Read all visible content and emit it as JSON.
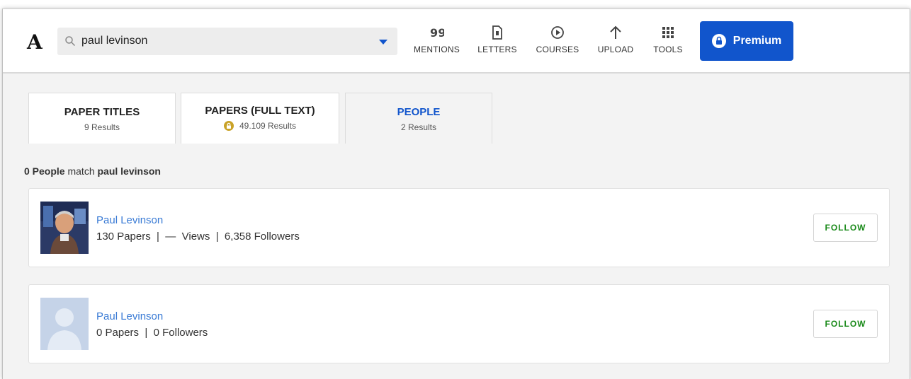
{
  "header": {
    "logo": "A",
    "search": {
      "value": "paul levinson",
      "placeholder": "Search"
    },
    "nav": [
      {
        "label": "MENTIONS",
        "icon": "quote-icon"
      },
      {
        "label": "LETTERS",
        "icon": "document-icon"
      },
      {
        "label": "COURSES",
        "icon": "play-circle-icon"
      },
      {
        "label": "UPLOAD",
        "icon": "arrow-up-icon"
      },
      {
        "label": "TOOLS",
        "icon": "grid-icon"
      }
    ],
    "premium_label": "Premium"
  },
  "tabs": [
    {
      "title": "PAPER TITLES",
      "sub": "9 Results"
    },
    {
      "title": "PAPERS (FULL TEXT)",
      "sub": "49.109 Results"
    },
    {
      "title": "PEOPLE",
      "sub": "2 Results"
    }
  ],
  "results": {
    "count_text": "0 People",
    "match_word": "match",
    "query": "paul levinson",
    "people": [
      {
        "name": "Paul Levinson",
        "stats": "130 Papers  |  —  Views  |  6,358 Followers",
        "follow": "FOLLOW"
      },
      {
        "name": "Paul Levinson",
        "stats": "0 Papers  |  0 Followers",
        "follow": "FOLLOW"
      }
    ]
  },
  "colors": {
    "accent": "#1155cc",
    "follow_green": "#1a8a1a",
    "link": "#3a7bd5"
  }
}
